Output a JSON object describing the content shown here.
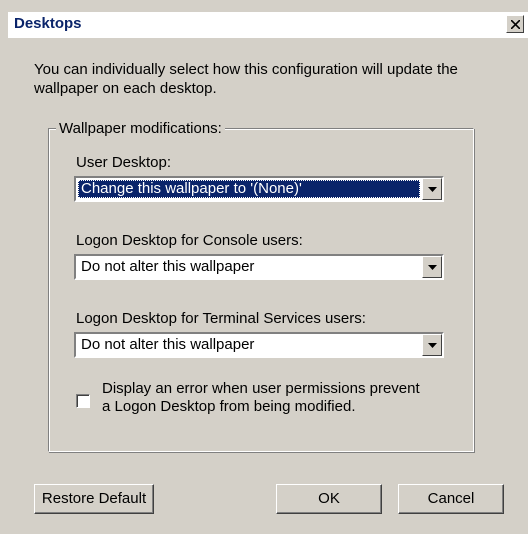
{
  "window": {
    "title": "Desktops"
  },
  "intro_text": "You can individually select how this configuration will update the wallpaper on each desktop.",
  "group": {
    "legend": "Wallpaper modifications:",
    "user_desktop": {
      "label": "User Desktop:",
      "value": "Change this wallpaper to '(None)'"
    },
    "console_desktop": {
      "label": "Logon Desktop for Console users:",
      "value": "Do not alter this wallpaper"
    },
    "terminal_desktop": {
      "label": "Logon Desktop for Terminal Services users:",
      "value": "Do not alter this wallpaper"
    },
    "error_checkbox": {
      "label": "Display an error when user permissions prevent a Logon Desktop from being modified.",
      "checked": false
    }
  },
  "buttons": {
    "restore_default": "Restore Default",
    "ok": "OK",
    "cancel": "Cancel"
  },
  "icons": {
    "close": "close-icon",
    "dropdown": "chevron-down-icon"
  },
  "colors": {
    "title_text": "#0a246a",
    "dialog_face": "#d4d0c8",
    "selection": "#0a246a"
  }
}
